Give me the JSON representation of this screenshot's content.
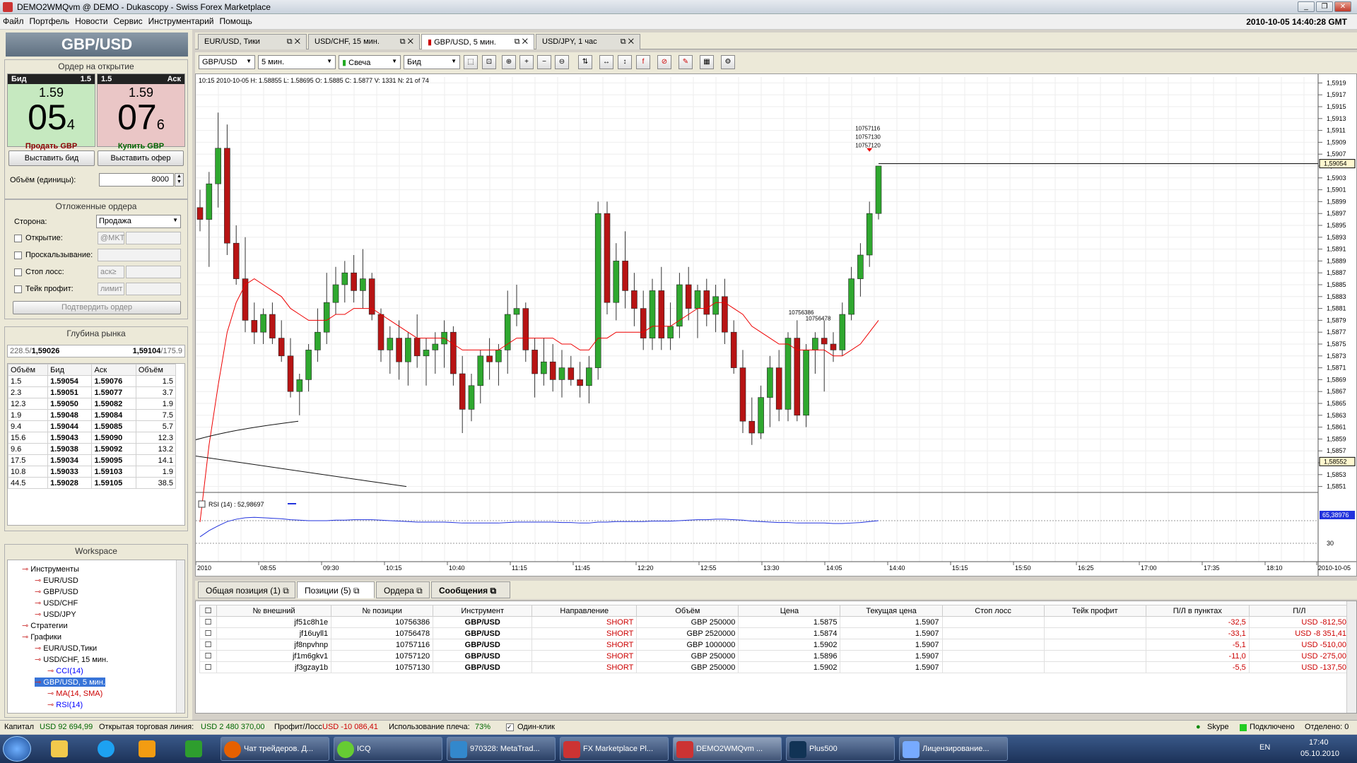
{
  "window": {
    "title": "DEMO2WMQvm @ DEMO - Dukascopy - Swiss Forex Marketplace",
    "clock": "2010-10-05 14:40:28 GMT"
  },
  "menu": [
    "Файл",
    "Портфель",
    "Новости",
    "Сервис",
    "Инструментарий",
    "Помощь"
  ],
  "order": {
    "pair": "GBP/USD",
    "title": "Ордер на открытие",
    "bid": {
      "label": "Бид",
      "size": "1.5",
      "big": "1.59",
      "main": "05",
      "pip": "4",
      "action": "Продать GBP"
    },
    "ask": {
      "label": "Аск",
      "size": "1.5",
      "big": "1.59",
      "main": "07",
      "pip": "6",
      "action": "Купить GBP"
    },
    "place_bid": "Выставить бид",
    "place_offer": "Выставить офер",
    "volume_label": "Объём (единицы):",
    "volume": "8000"
  },
  "pending": {
    "title": "Отложенные ордера",
    "side_label": "Сторона:",
    "side": "Продажа",
    "open_label": "Открытие:",
    "open_ph": "@MKT",
    "slip_label": "Проскальзывание:",
    "sl_label": "Стоп лосс:",
    "sl_ph": "аск≥",
    "tp_label": "Тейк профит:",
    "tp_ph": "лимит",
    "confirm": "Подтвердить ордер"
  },
  "depth": {
    "title": "Глубина рынка",
    "bid_summary": "228.5/",
    "bid_price": "1,59026",
    "ask_price": "1,59104",
    "ask_summary": "/175.9",
    "headers": [
      "Объём",
      "Бид",
      "Аск",
      "Объём"
    ],
    "rows": [
      [
        "1.5",
        "1.59054",
        "1.59076",
        "1.5"
      ],
      [
        "2.3",
        "1.59051",
        "1.59077",
        "3.7"
      ],
      [
        "12.3",
        "1.59050",
        "1.59082",
        "1.9"
      ],
      [
        "1.9",
        "1.59048",
        "1.59084",
        "7.5"
      ],
      [
        "9.4",
        "1.59044",
        "1.59085",
        "5.7"
      ],
      [
        "15.6",
        "1.59043",
        "1.59090",
        "12.3"
      ],
      [
        "9.6",
        "1.59038",
        "1.59092",
        "13.2"
      ],
      [
        "17.5",
        "1.59034",
        "1.59095",
        "14.1"
      ],
      [
        "10.8",
        "1.59033",
        "1.59103",
        "1.9"
      ],
      [
        "44.5",
        "1.59028",
        "1.59105",
        "38.5"
      ]
    ]
  },
  "workspace": {
    "title": "Workspace",
    "items": [
      "Инструменты",
      "EUR/USD",
      "GBP/USD",
      "USD/CHF",
      "USD/JPY",
      "Стратегии",
      "Графики",
      "EUR/USD,Тики",
      "USD/CHF, 15 мин.",
      "CCI(14)",
      "GBP/USD, 5 мин.",
      "MA(14, SMA)",
      "RSI(14)"
    ]
  },
  "chart_tabs": [
    "EUR/USD, Тики",
    "USD/CHF, 15 мин.",
    "GBP/USD, 5 мин.",
    "USD/JPY, 1 час"
  ],
  "toolbar": {
    "instrument": "GBP/USD",
    "period": "5 мин.",
    "type": "Свеча",
    "side": "Бид"
  },
  "chart_info": "10:15 2010-10-05 H: 1.58855 L: 1.58695 O: 1.5885 C: 1.5877 V: 1331 N: 21 of 74",
  "chart_data": {
    "type": "candlestick",
    "price_axis": [
      "1,5919",
      "1,5917",
      "1,5915",
      "1,5913",
      "1,5911",
      "1,5909",
      "1,5907",
      "1,5905",
      "1,5903",
      "1,5901",
      "1,5899",
      "1,5897",
      "1,5895",
      "1,5893",
      "1,5891",
      "1,5889",
      "1,5887",
      "1,5885",
      "1,5883",
      "1,5881",
      "1,5879",
      "1,5877",
      "1,5875",
      "1,5873",
      "1,5871",
      "1,5869",
      "1,5867",
      "1,5865",
      "1,5863",
      "1,5861",
      "1,5859",
      "1,5857",
      "1,5855",
      "1,5853",
      "1,5851"
    ],
    "time_axis": [
      "2010",
      "08:55",
      "09:30",
      "10:15",
      "10:40",
      "11:15",
      "11:45",
      "12:20",
      "12:55",
      "13:30",
      "14:05",
      "14:40",
      "15:15",
      "15:50",
      "16:25",
      "17:00",
      "17:35",
      "18:10",
      "2010-10-05"
    ],
    "current_price": "1,59054",
    "low_marker": "1,58552",
    "order_labels": [
      "10757116",
      "10757130",
      "10757120",
      "10756386",
      "10756478"
    ],
    "rsi_label": "RSI (14) : 52,98697",
    "rsi_value": "65,38976",
    "rsi_level": "30",
    "candles": [
      [
        1.5898,
        1.5901,
        1.5894,
        1.5896
      ],
      [
        1.5896,
        1.5904,
        1.5888,
        1.5902
      ],
      [
        1.5902,
        1.5914,
        1.5898,
        1.5908
      ],
      [
        1.5908,
        1.5912,
        1.589,
        1.5892
      ],
      [
        1.5892,
        1.5895,
        1.5885,
        1.5886
      ],
      [
        1.5886,
        1.5893,
        1.5877,
        1.5879
      ],
      [
        1.5879,
        1.5882,
        1.5875,
        1.5877
      ],
      [
        1.5877,
        1.5881,
        1.5875,
        1.588
      ],
      [
        1.588,
        1.5882,
        1.5875,
        1.5876
      ],
      [
        1.5876,
        1.5879,
        1.5872,
        1.5873
      ],
      [
        1.5873,
        1.5876,
        1.5866,
        1.5867
      ],
      [
        1.5867,
        1.587,
        1.5863,
        1.5869
      ],
      [
        1.5869,
        1.5875,
        1.5867,
        1.5874
      ],
      [
        1.5874,
        1.5881,
        1.5872,
        1.5877
      ],
      [
        1.5877,
        1.5887,
        1.5875,
        1.5882
      ],
      [
        1.5882,
        1.5888,
        1.588,
        1.5885
      ],
      [
        1.5885,
        1.5889,
        1.5882,
        1.5887
      ],
      [
        1.5887,
        1.589,
        1.5882,
        1.5884
      ],
      [
        1.5884,
        1.5891,
        1.5881,
        1.5886
      ],
      [
        1.5886,
        1.5887,
        1.5879,
        1.588
      ],
      [
        1.588,
        1.5881,
        1.5872,
        1.5874
      ],
      [
        1.5874,
        1.5878,
        1.587,
        1.5876
      ],
      [
        1.5876,
        1.5879,
        1.5869,
        1.5872
      ],
      [
        1.5872,
        1.5877,
        1.5868,
        1.5876
      ],
      [
        1.5876,
        1.588,
        1.5871,
        1.5873
      ],
      [
        1.5873,
        1.5876,
        1.5868,
        1.5874
      ],
      [
        1.5874,
        1.5877,
        1.587,
        1.5875
      ],
      [
        1.5875,
        1.5879,
        1.5871,
        1.5877
      ],
      [
        1.5877,
        1.5878,
        1.5868,
        1.587
      ],
      [
        1.587,
        1.5873,
        1.586,
        1.5864
      ],
      [
        1.5864,
        1.587,
        1.5862,
        1.5868
      ],
      [
        1.5868,
        1.5874,
        1.5865,
        1.5873
      ],
      [
        1.5873,
        1.5876,
        1.5869,
        1.5872
      ],
      [
        1.5872,
        1.5875,
        1.5868,
        1.5874
      ],
      [
        1.5874,
        1.5884,
        1.587,
        1.588
      ],
      [
        1.588,
        1.5885,
        1.5878,
        1.5881
      ],
      [
        1.5881,
        1.5882,
        1.5872,
        1.5874
      ],
      [
        1.5874,
        1.5876,
        1.5866,
        1.587
      ],
      [
        1.587,
        1.5876,
        1.5868,
        1.5872
      ],
      [
        1.5872,
        1.5875,
        1.5867,
        1.5869
      ],
      [
        1.5869,
        1.5874,
        1.5866,
        1.5871
      ],
      [
        1.5871,
        1.5873,
        1.5868,
        1.5869
      ],
      [
        1.5869,
        1.5872,
        1.5866,
        1.5868
      ],
      [
        1.5868,
        1.5873,
        1.5865,
        1.5871
      ],
      [
        1.5871,
        1.5899,
        1.5869,
        1.5897
      ],
      [
        1.5897,
        1.5899,
        1.588,
        1.5882
      ],
      [
        1.5882,
        1.5892,
        1.5879,
        1.5889
      ],
      [
        1.5889,
        1.5894,
        1.5881,
        1.5884
      ],
      [
        1.5884,
        1.5887,
        1.5878,
        1.5881
      ],
      [
        1.5881,
        1.5884,
        1.5874,
        1.5876
      ],
      [
        1.5876,
        1.5886,
        1.5874,
        1.5884
      ],
      [
        1.5884,
        1.5888,
        1.5874,
        1.5876
      ],
      [
        1.5876,
        1.5882,
        1.5874,
        1.5878
      ],
      [
        1.5878,
        1.5887,
        1.5876,
        1.5885
      ],
      [
        1.5885,
        1.5888,
        1.5879,
        1.5881
      ],
      [
        1.5881,
        1.5885,
        1.5876,
        1.5884
      ],
      [
        1.5884,
        1.5886,
        1.5878,
        1.588
      ],
      [
        1.588,
        1.5885,
        1.5877,
        1.5883
      ],
      [
        1.5883,
        1.5886,
        1.5875,
        1.5877
      ],
      [
        1.5877,
        1.5879,
        1.587,
        1.5871
      ],
      [
        1.5871,
        1.5874,
        1.586,
        1.5862
      ],
      [
        1.5862,
        1.5866,
        1.5858,
        1.586
      ],
      [
        1.586,
        1.5868,
        1.5859,
        1.5866
      ],
      [
        1.5866,
        1.5873,
        1.5861,
        1.5871
      ],
      [
        1.5871,
        1.5874,
        1.5862,
        1.5864
      ],
      [
        1.5864,
        1.5877,
        1.5862,
        1.5876
      ],
      [
        1.5876,
        1.5879,
        1.5862,
        1.5863
      ],
      [
        1.5863,
        1.5875,
        1.5861,
        1.5874
      ],
      [
        1.5874,
        1.5877,
        1.587,
        1.5876
      ],
      [
        1.5876,
        1.5879,
        1.5867,
        1.5875
      ],
      [
        1.5875,
        1.5877,
        1.5872,
        1.5874
      ],
      [
        1.5874,
        1.5882,
        1.5873,
        1.588
      ],
      [
        1.588,
        1.5888,
        1.5879,
        1.5886
      ],
      [
        1.5886,
        1.5892,
        1.5883,
        1.589
      ],
      [
        1.589,
        1.5899,
        1.5888,
        1.5897
      ],
      [
        1.5897,
        1.5903,
        1.5896,
        1.5905
      ]
    ],
    "ma": [
      1.5845,
      1.5858,
      1.5868,
      1.5877,
      1.5882,
      1.5885,
      1.5886,
      1.5885,
      1.5884,
      1.5883,
      1.5881,
      1.588,
      1.5879,
      1.5879,
      1.5879,
      1.588,
      1.588,
      1.5881,
      1.5881,
      1.5881,
      1.588,
      1.5879,
      1.5878,
      1.5877,
      1.5876,
      1.5876,
      1.5876,
      1.5876,
      1.5875,
      1.5874,
      1.5874,
      1.5874,
      1.5874,
      1.5874,
      1.5875,
      1.5876,
      1.5876,
      1.5876,
      1.5876,
      1.5876,
      1.5875,
      1.5875,
      1.5874,
      1.5874,
      1.5876,
      1.5876,
      1.5877,
      1.5877,
      1.5877,
      1.5877,
      1.5878,
      1.5878,
      1.5878,
      1.5879,
      1.588,
      1.5881,
      1.5881,
      1.5882,
      1.5882,
      1.5881,
      1.588,
      1.5878,
      1.5877,
      1.5876,
      1.5875,
      1.5875,
      1.5874,
      1.5874,
      1.5874,
      1.5874,
      1.5873,
      1.5873,
      1.5874,
      1.5875,
      1.5877,
      1.5879
    ]
  },
  "bottom_tabs": [
    "Общая позиция (1)",
    "Позиции (5)",
    "Ордера",
    "Сообщения"
  ],
  "positions": {
    "headers": [
      "№ внешний",
      "№ позиции",
      "Инструмент",
      "Направление",
      "Объём",
      "Цена",
      "Текущая цена",
      "Стоп лосс",
      "Тейк профит",
      "П/Л в пунктах",
      "П/Л"
    ],
    "rows": [
      [
        "jf51c8h1e",
        "10756386",
        "GBP/USD",
        "SHORT",
        "GBP 250000",
        "1.5875",
        "1.5907",
        "",
        "",
        "-32,5",
        "USD -812,50"
      ],
      [
        "jf16uyll1",
        "10756478",
        "GBP/USD",
        "SHORT",
        "GBP 2520000",
        "1.5874",
        "1.5907",
        "",
        "",
        "-33,1",
        "USD -8 351,41"
      ],
      [
        "jf8npvhnp",
        "10757116",
        "GBP/USD",
        "SHORT",
        "GBP 1000000",
        "1.5902",
        "1.5907",
        "",
        "",
        "-5,1",
        "USD -510,00"
      ],
      [
        "jf1m6gkv1",
        "10757120",
        "GBP/USD",
        "SHORT",
        "GBP 250000",
        "1.5896",
        "1.5907",
        "",
        "",
        "-11,0",
        "USD -275,00"
      ],
      [
        "jf3gzay1b",
        "10757130",
        "GBP/USD",
        "SHORT",
        "GBP 250000",
        "1.5902",
        "1.5907",
        "",
        "",
        "-5,5",
        "USD -137,50"
      ]
    ],
    "price_sub": [
      "1",
      "4",
      "5",
      "6",
      "1"
    ]
  },
  "status": {
    "capital_label": "Капитал",
    "capital": "USD 92 694,99",
    "open_line_label": "Открытая торговая линия:",
    "open_line": "USD 2 480 370,00",
    "pl_label": "Профит/Лосс",
    "pl": "USD -10 086,41",
    "leverage_label": "Использование плеча:",
    "leverage": "73%",
    "oneclick": "Один-клик",
    "skype": "Skype",
    "connected": "Подключено",
    "selected": "Отделено: 0"
  },
  "taskbar": {
    "tasks": [
      "Чат трейдеров. Д...",
      "ICQ",
      "970328: MetaTrad...",
      "FX Marketplace Pl...",
      "DEMO2WMQvm ...",
      "Plus500",
      "Лицензирование..."
    ],
    "lang": "EN",
    "time": "17:40",
    "date": "05.10.2010"
  }
}
